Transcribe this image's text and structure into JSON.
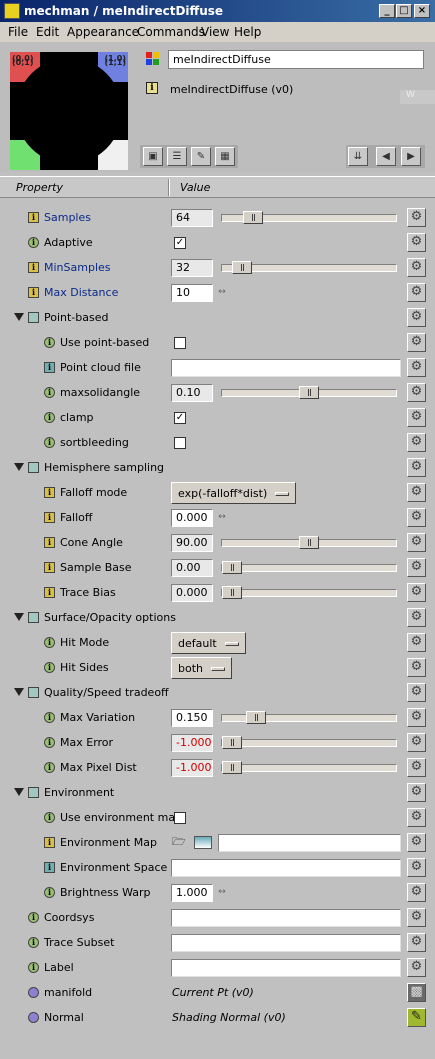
{
  "window": {
    "title": "mechman / meIndirectDiffuse"
  },
  "menu": [
    "File",
    "Edit",
    "Appearance",
    "Commands",
    "View",
    "Help"
  ],
  "header": {
    "node_name": "meIndirectDiffuse",
    "version_label": "meIndirectDiffuse (v0)",
    "swatch_corners": [
      "(0,0)",
      "(1,0)",
      "(0,1)",
      "(1,1)"
    ],
    "ghost_label": "W"
  },
  "columns": {
    "property": "Property",
    "value": "Value"
  },
  "rows": [
    {
      "label": "Samples",
      "value": "64",
      "slider": 0.17
    },
    {
      "label": "Adaptive",
      "check": true
    },
    {
      "label": "MinSamples",
      "value": "32",
      "slider": 0.09
    },
    {
      "label": "Max Distance",
      "value": "10"
    },
    {
      "label": "Point-based"
    },
    {
      "label": "Use point-based",
      "check": false
    },
    {
      "label": "Point cloud file",
      "text": ""
    },
    {
      "label": "maxsolidangle",
      "value": "0.10",
      "slider": 0.5
    },
    {
      "label": "clamp",
      "check": true
    },
    {
      "label": "sortbleeding",
      "check": false
    },
    {
      "label": "Hemisphere sampling"
    },
    {
      "label": "Falloff mode",
      "menu": "exp(-falloff*dist)"
    },
    {
      "label": "Falloff",
      "value": "0.000"
    },
    {
      "label": "Cone Angle",
      "value": "90.00",
      "slider": 0.5
    },
    {
      "label": "Sample Base",
      "value": "0.00",
      "slider": 0
    },
    {
      "label": "Trace Bias",
      "value": "0.000",
      "slider": 0
    },
    {
      "label": "Surface/Opacity options"
    },
    {
      "label": "Hit Mode",
      "menu": "default"
    },
    {
      "label": "Hit Sides",
      "menu": "both"
    },
    {
      "label": "Quality/Speed tradeoff"
    },
    {
      "label": "Max Variation",
      "value": "0.150",
      "slider": 0.15
    },
    {
      "label": "Max Error",
      "value": "-1.000",
      "slider": 0
    },
    {
      "label": "Max Pixel Dist",
      "value": "-1.000",
      "slider": 0
    },
    {
      "label": "Environment"
    },
    {
      "label": "Use environment map",
      "check": false
    },
    {
      "label": "Environment Map",
      "text": ""
    },
    {
      "label": "Environment Space",
      "text": ""
    },
    {
      "label": "Brightness Warp",
      "value": "1.000"
    },
    {
      "label": "Coordsys",
      "text": ""
    },
    {
      "label": "Trace Subset",
      "text": ""
    },
    {
      "label": "Label",
      "text": ""
    },
    {
      "label": "manifold",
      "italic": "Current Pt (v0)"
    },
    {
      "label": "Normal",
      "italic": "Shading Normal (v0)"
    }
  ],
  "icons": {
    "gear": "gear-icon",
    "info": "info-icon"
  }
}
